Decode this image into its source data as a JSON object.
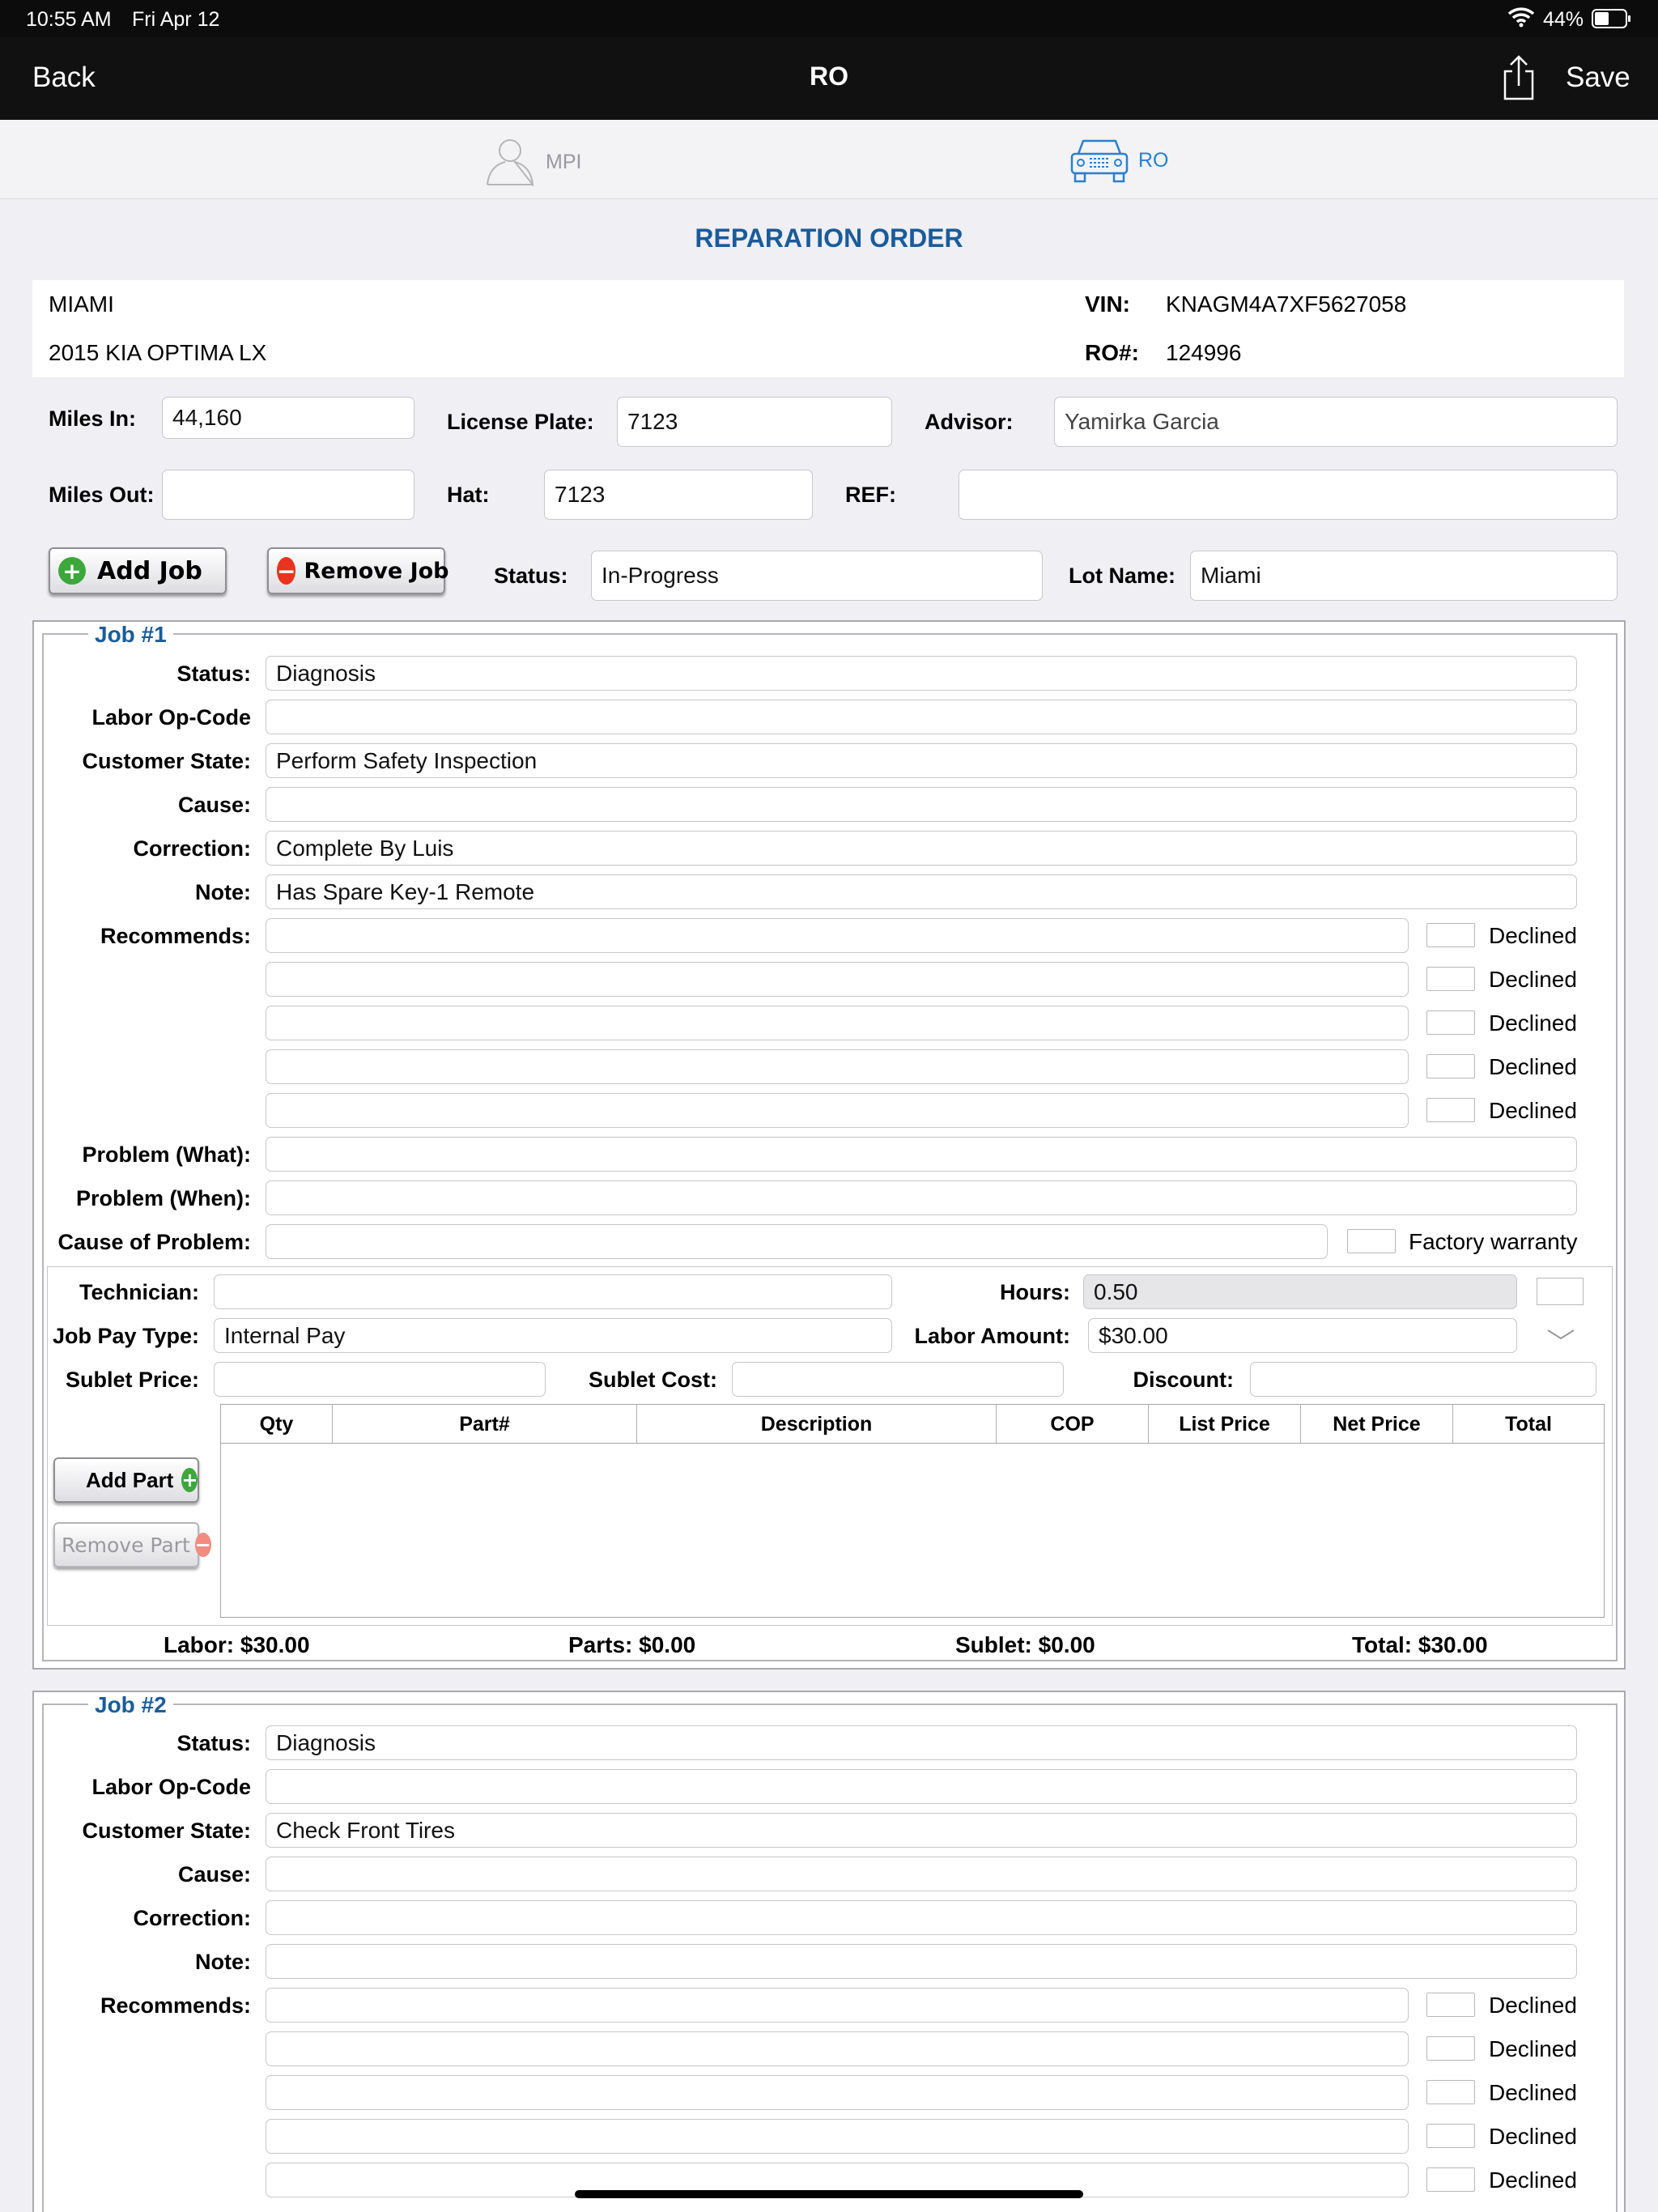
{
  "status_bar": {
    "time": "10:55 AM",
    "date": "Fri Apr 12",
    "battery": "44%"
  },
  "nav": {
    "back": "Back",
    "title": "RO",
    "save": "Save"
  },
  "segments": {
    "mpi": "MPI",
    "ro": "RO"
  },
  "page_title": "REPARATION ORDER",
  "vehicle": {
    "location": "MIAMI",
    "model": "2015 KIA OPTIMA LX",
    "vin_label": "VIN:",
    "vin": "KNAGM4A7XF5627058",
    "ro_label": "RO#:",
    "ro": "124996"
  },
  "form": {
    "miles_in_label": "Miles In:",
    "miles_in": "44,160",
    "license_label": "License Plate:",
    "license": "7123",
    "advisor_label": "Advisor:",
    "advisor": "Yamirka Garcia",
    "miles_out_label": "Miles Out:",
    "miles_out": "",
    "hat_label": "Hat:",
    "hat": "7123",
    "ref_label": "REF:",
    "ref": "",
    "add_job": "Add Job",
    "remove_job": "Remove Job",
    "status_label": "Status:",
    "status": "In-Progress",
    "lot_label": "Lot Name:",
    "lot": "Miami"
  },
  "labels": {
    "status": "Status:",
    "labor_op": "Labor Op-Code",
    "customer_state": "Customer State:",
    "cause": "Cause:",
    "correction": "Correction:",
    "note": "Note:",
    "recommends": "Recommends:",
    "declined": "Declined",
    "problem_what": "Problem (What):",
    "problem_when": "Problem (When):",
    "cause_problem": "Cause of Problem:",
    "factory_warranty": "Factory warranty",
    "technician": "Technician:",
    "hours": "Hours:",
    "job_pay_type": "Job Pay Type:",
    "labor_amount": "Labor Amount:",
    "sublet_price": "Sublet Price:",
    "sublet_cost": "Sublet Cost:",
    "discount": "Discount:",
    "add_part": "Add Part",
    "remove_part": "Remove Part"
  },
  "parts_table": {
    "headers": [
      "Qty",
      "Part#",
      "Description",
      "COP",
      "List Price",
      "Net Price",
      "Total"
    ]
  },
  "job1": {
    "title": "Job #1",
    "status": "Diagnosis",
    "labor_op": "",
    "customer_state": "Perform Safety Inspection",
    "cause": "",
    "correction": "Complete By Luis",
    "note": "Has Spare Key-1 Remote",
    "technician": "",
    "hours": "0.50",
    "job_pay_type": "Internal Pay",
    "labor_amount": "$30.00",
    "sublet_price": "",
    "sublet_cost": "",
    "discount": "",
    "totals": {
      "labor": "Labor: $30.00",
      "parts": "Parts: $0.00",
      "sublet": "Sublet: $0.00",
      "total": "Total: $30.00"
    }
  },
  "job2": {
    "title": "Job #2",
    "status": "Diagnosis",
    "labor_op": "",
    "customer_state": "Check Front Tires",
    "cause": "",
    "correction": "",
    "note": ""
  }
}
